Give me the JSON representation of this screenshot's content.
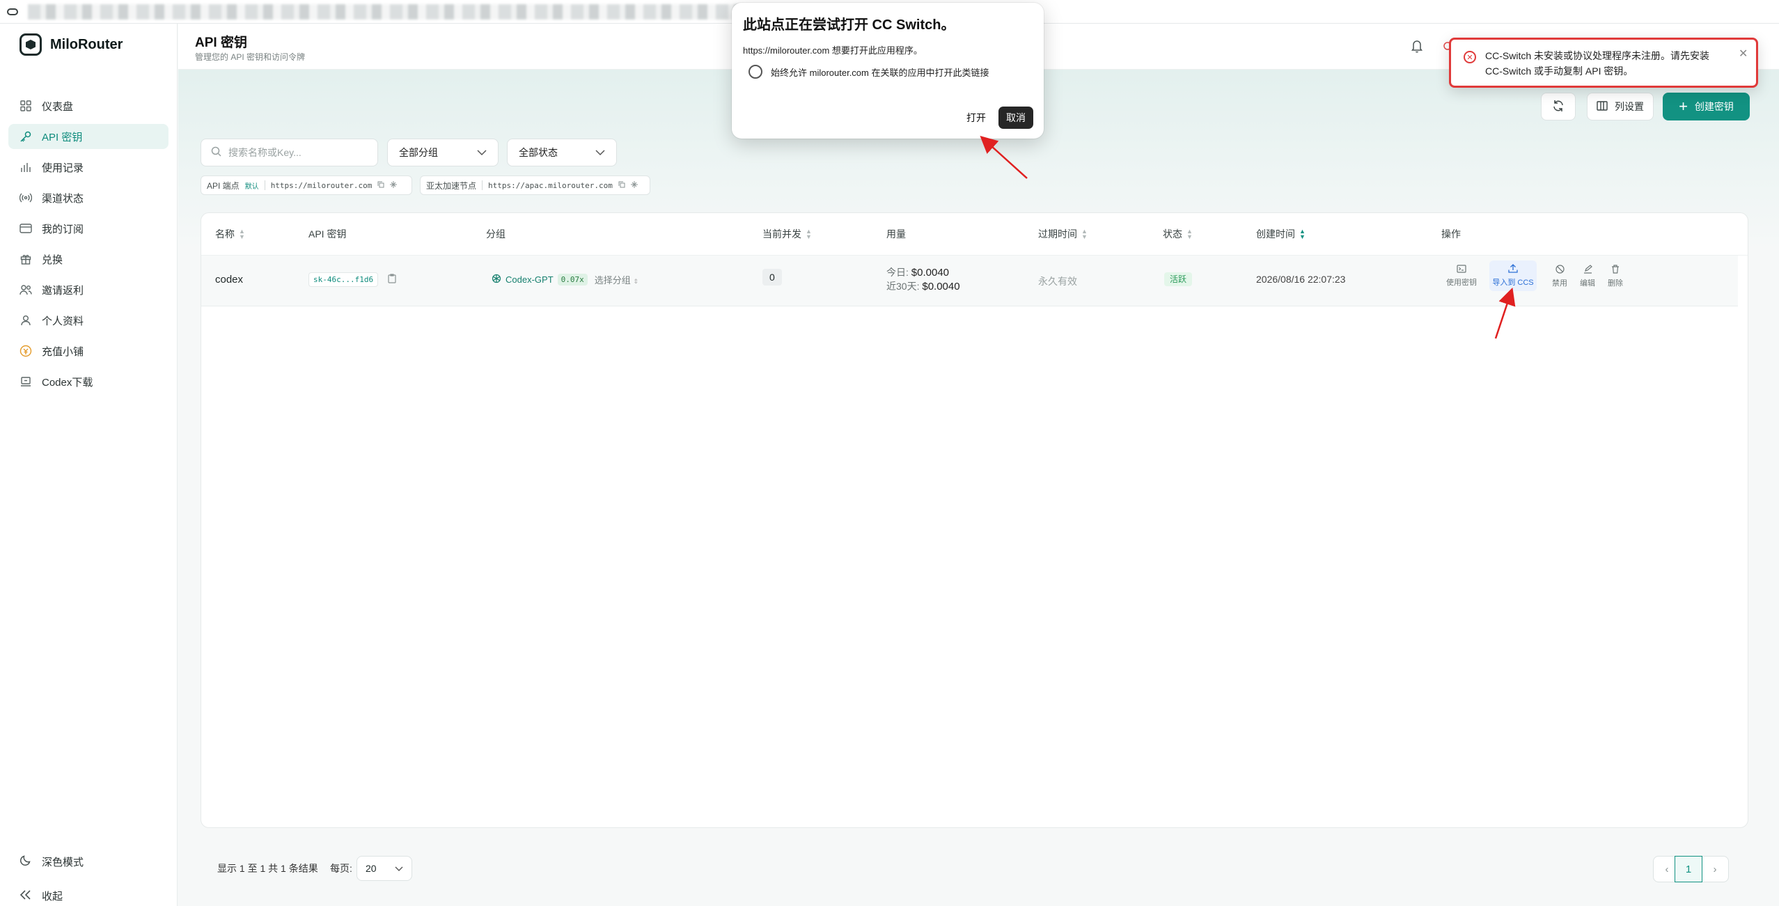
{
  "sidebar": {
    "brand": "MiloRouter",
    "items": [
      {
        "label": "仪表盘",
        "icon": "dashboard-icon"
      },
      {
        "label": "API 密钥",
        "icon": "key-icon"
      },
      {
        "label": "使用记录",
        "icon": "bar-chart-icon"
      },
      {
        "label": "渠道状态",
        "icon": "signal-icon"
      },
      {
        "label": "我的订阅",
        "icon": "credit-card-icon"
      },
      {
        "label": "兑换",
        "icon": "gift-icon"
      },
      {
        "label": "邀请返利",
        "icon": "users-icon"
      },
      {
        "label": "个人资料",
        "icon": "user-icon"
      },
      {
        "label": "充值小铺",
        "icon": "coin-icon"
      },
      {
        "label": "Codex下载",
        "icon": "download-icon"
      }
    ],
    "active_index": 1,
    "dark_mode": "深色模式",
    "collapse": "收起"
  },
  "header": {
    "title": "API 密钥",
    "subtitle": "管理您的 API 密钥和访问令牌"
  },
  "toolbar": {
    "columns_label": "列设置",
    "create_label": "创建密钥"
  },
  "filters": {
    "search_placeholder": "搜索名称或Key...",
    "group": "全部分组",
    "status": "全部状态"
  },
  "endpoints": [
    {
      "label": "API 端点",
      "tag": "默认",
      "url": "https://milorouter.com"
    },
    {
      "label": "亚太加速节点",
      "tag": "",
      "url": "https://apac.milorouter.com"
    }
  ],
  "table": {
    "columns": [
      "名称",
      "API 密钥",
      "分组",
      "当前并发",
      "用量",
      "过期时间",
      "状态",
      "创建时间",
      "操作"
    ],
    "rows": [
      {
        "name": "codex",
        "key": "sk-46c...f1d6",
        "group": "Codex-GPT",
        "ratio": "0.07x",
        "pick_group": "选择分组",
        "concurrency": "0",
        "usage_today_label": "今日:",
        "usage_today": "$0.0040",
        "usage_30d_label": "近30天:",
        "usage_30d": "$0.0040",
        "expires": "永久有效",
        "status": "活跃",
        "created": "2026/08/16 22:07:23"
      }
    ],
    "actions": [
      "使用密钥",
      "导入到 CCS",
      "禁用",
      "编辑",
      "删除"
    ]
  },
  "pagination": {
    "info": "显示 1 至 1 共 1 条结果",
    "per_page_label": "每页:",
    "per_page": "20",
    "current_page": "1"
  },
  "dialog": {
    "title": "此站点正在尝试打开 CC Switch。",
    "message": "https://milorouter.com 想要打开此应用程序。",
    "checkbox": "始终允许 milorouter.com 在关联的应用中打开此类链接",
    "open": "打开",
    "cancel": "取消"
  },
  "toast": {
    "text": "CC-Switch 未安装或协议处理程序未注册。请先安装 CC-Switch 或手动复制 API 密钥。",
    "color": "#e03a3a"
  },
  "colors": {
    "accent": "#129282",
    "active_nav_bg": "#e8f4f2",
    "annotation_arrow": "#e02020"
  }
}
